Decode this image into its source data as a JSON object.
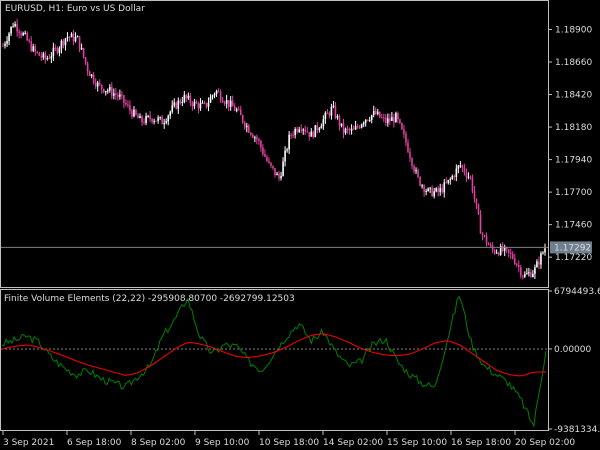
{
  "main_chart": {
    "title": "EURUSD, H1:  Euro vs US Dollar",
    "current_price": "1.17292",
    "price_ticks": [
      "1.18900",
      "1.18660",
      "1.18420",
      "1.18180",
      "1.17940",
      "1.17700",
      "1.17460",
      "1.17220"
    ],
    "price_tick_values": [
      1.189,
      1.1866,
      1.1842,
      1.1818,
      1.1794,
      1.177,
      1.1746,
      1.1722
    ],
    "price_range": [
      1.17,
      1.1911
    ],
    "colors": {
      "background": "#000000",
      "bull": "#ffffff",
      "bear": "#e040a0",
      "axis": "#c0c0c0",
      "price_line": "#808080"
    }
  },
  "indicator": {
    "label": "Finite Volume Elements (22,22) -295908.80700 -2692799.12503",
    "scale_ticks": [
      "6794493.67",
      "0.00000",
      "-9381334.8"
    ],
    "scale_tick_values": [
      6794493.67,
      0,
      -9381334.8
    ],
    "range": [
      -9381334.8,
      6794493.67
    ],
    "colors": {
      "fve": "#008000",
      "signal": "#ff0000",
      "zero_line": "#808080"
    }
  },
  "time_axis": {
    "labels": [
      "3 Sep 2021",
      "6 Sep 18:00",
      "8 Sep 02:00",
      "9 Sep 10:00",
      "10 Sep 18:00",
      "14 Sep 02:00",
      "15 Sep 10:00",
      "16 Sep 18:00",
      "20 Sep 02:00"
    ]
  },
  "chart_data": [
    {
      "type": "candlestick",
      "title": "EURUSD, H1:  Euro vs US Dollar",
      "x_labels": [
        "3 Sep 2021",
        "6 Sep 18:00",
        "8 Sep 02:00",
        "9 Sep 10:00",
        "10 Sep 18:00",
        "14 Sep 02:00",
        "15 Sep 10:00",
        "16 Sep 18:00",
        "20 Sep 02:00"
      ],
      "ylim": [
        1.17,
        1.1911
      ],
      "y_ticks": [
        1.189,
        1.1866,
        1.1842,
        1.1818,
        1.1794,
        1.177,
        1.1746,
        1.1722
      ],
      "last_price": 1.17292,
      "close_path": [
        1.1878,
        1.1895,
        1.1885,
        1.1873,
        1.1868,
        1.1875,
        1.1885,
        1.1883,
        1.186,
        1.1848,
        1.1845,
        1.184,
        1.183,
        1.1822,
        1.1825,
        1.1822,
        1.1832,
        1.184,
        1.1835,
        1.1833,
        1.1845,
        1.1837,
        1.183,
        1.1818,
        1.1808,
        1.179,
        1.178,
        1.1812,
        1.182,
        1.1812,
        1.1822,
        1.1832,
        1.1815,
        1.1815,
        1.1824,
        1.1828,
        1.1822,
        1.1825,
        1.1805,
        1.178,
        1.177,
        1.177,
        1.1778,
        1.179,
        1.178,
        1.174,
        1.1727,
        1.1727,
        1.1722,
        1.1708,
        1.1712,
        1.1729
      ]
    },
    {
      "type": "line",
      "title": "Finite Volume Elements (22,22) -295908.80700 -2692799.12503",
      "x_labels": [
        "3 Sep 2021",
        "6 Sep 18:00",
        "8 Sep 02:00",
        "9 Sep 10:00",
        "10 Sep 18:00",
        "14 Sep 02:00",
        "15 Sep 10:00",
        "16 Sep 18:00",
        "20 Sep 02:00"
      ],
      "ylim": [
        -9381334.8,
        6794493.67
      ],
      "y_ticks": [
        6794493.67,
        0,
        -9381334.8
      ],
      "series": [
        {
          "values": [
            600000,
            1000000,
            1500000,
            800000,
            -1000000,
            -2200000,
            -3000000,
            -2500000,
            -3500000,
            -4000000,
            -4500000,
            -3200000,
            -2000000,
            1500000,
            3500000,
            6000000,
            1500000,
            -600000,
            500000,
            300000,
            -1500000,
            -2500000,
            -500000,
            1500000,
            3000000,
            1000000,
            2000000,
            -400000,
            -2000000,
            -1500000,
            500000,
            1200000,
            -1500000,
            -3000000,
            -4000000,
            -4500000,
            1000000,
            6500000,
            500000,
            -2000000,
            -3000000,
            -4000000,
            -6000000,
            -9000000,
            0
          ]
        },
        {
          "values": [
            0,
            300000,
            500000,
            200000,
            -300000,
            -800000,
            -1400000,
            -1900000,
            -2300000,
            -2700000,
            -3100000,
            -2800000,
            -2000000,
            -1000000,
            0,
            800000,
            600000,
            200000,
            -400000,
            -900000,
            -1000000,
            -800000,
            -400000,
            200000,
            1000000,
            1600000,
            1800000,
            1400000,
            800000,
            100000,
            -400000,
            -700000,
            -800000,
            -600000,
            0,
            700000,
            1000000,
            500000,
            -500000,
            -1500000,
            -2500000,
            -3000000,
            -3200000,
            -2700000,
            -2700000
          ]
        }
      ]
    }
  ]
}
